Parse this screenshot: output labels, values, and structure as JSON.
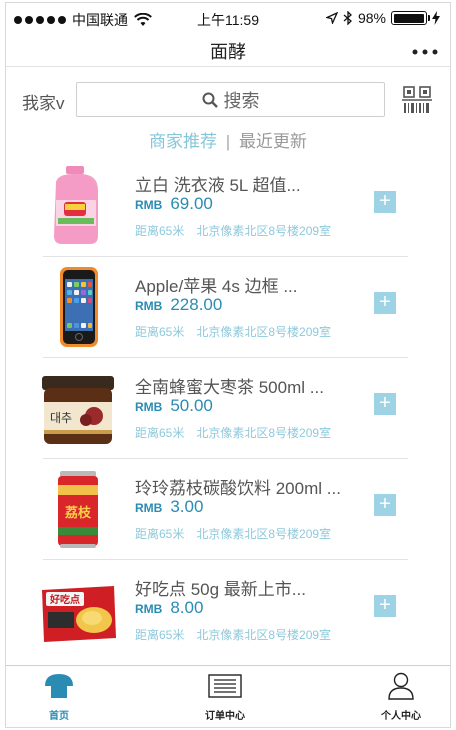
{
  "status_bar": {
    "carrier": "中国联通",
    "time": "上午11:59",
    "battery": "98%",
    "battery_level": 0.98
  },
  "nav": {
    "title": "面酵",
    "more_icon": "ellipsis-icon"
  },
  "search": {
    "location": "我家v",
    "placeholder": "搜索",
    "qr_icon": "qr-code-icon"
  },
  "tabs": {
    "active": "商家推荐",
    "separator": "|",
    "inactive": "最近更新"
  },
  "products": [
    {
      "name": "立白 洗衣液 5L 超值...",
      "currency": "RMB",
      "price": "69.00",
      "distance": "距离65米",
      "address": "北京像素北区8号楼209室",
      "image": "detergent-bottle"
    },
    {
      "name": "Apple/苹果 4s 边框 ...",
      "currency": "RMB",
      "price": "228.00",
      "distance": "距离65米",
      "address": "北京像素北区8号楼209室",
      "image": "iphone-with-orange-bumper"
    },
    {
      "name": "全南蜂蜜大枣茶 500ml ...",
      "currency": "RMB",
      "price": "50.00",
      "distance": "距离65米",
      "address": "北京像素北区8号楼209室",
      "image": "jujube-tea-jar",
      "label_text": "대추"
    },
    {
      "name": "玲玲荔枝碳酸饮料 200ml ...",
      "currency": "RMB",
      "price": "3.00",
      "distance": "距离65米",
      "address": "北京像素北区8号楼209室",
      "image": "lychee-soda-can",
      "label_text": "荔枝"
    },
    {
      "name": "好吃点 50g 最新上市...",
      "currency": "RMB",
      "price": "8.00",
      "distance": "距离65米",
      "address": "北京像素北区8号楼209室",
      "image": "biscuit-pack",
      "label_text": "好吃点"
    }
  ],
  "tab_bar": {
    "home": "首页",
    "orders": "订单中心",
    "profile": "个人中心"
  },
  "colors": {
    "accent": "#2a8cb3",
    "light_accent": "#86c6d9",
    "add_button": "#9ed3e5"
  }
}
